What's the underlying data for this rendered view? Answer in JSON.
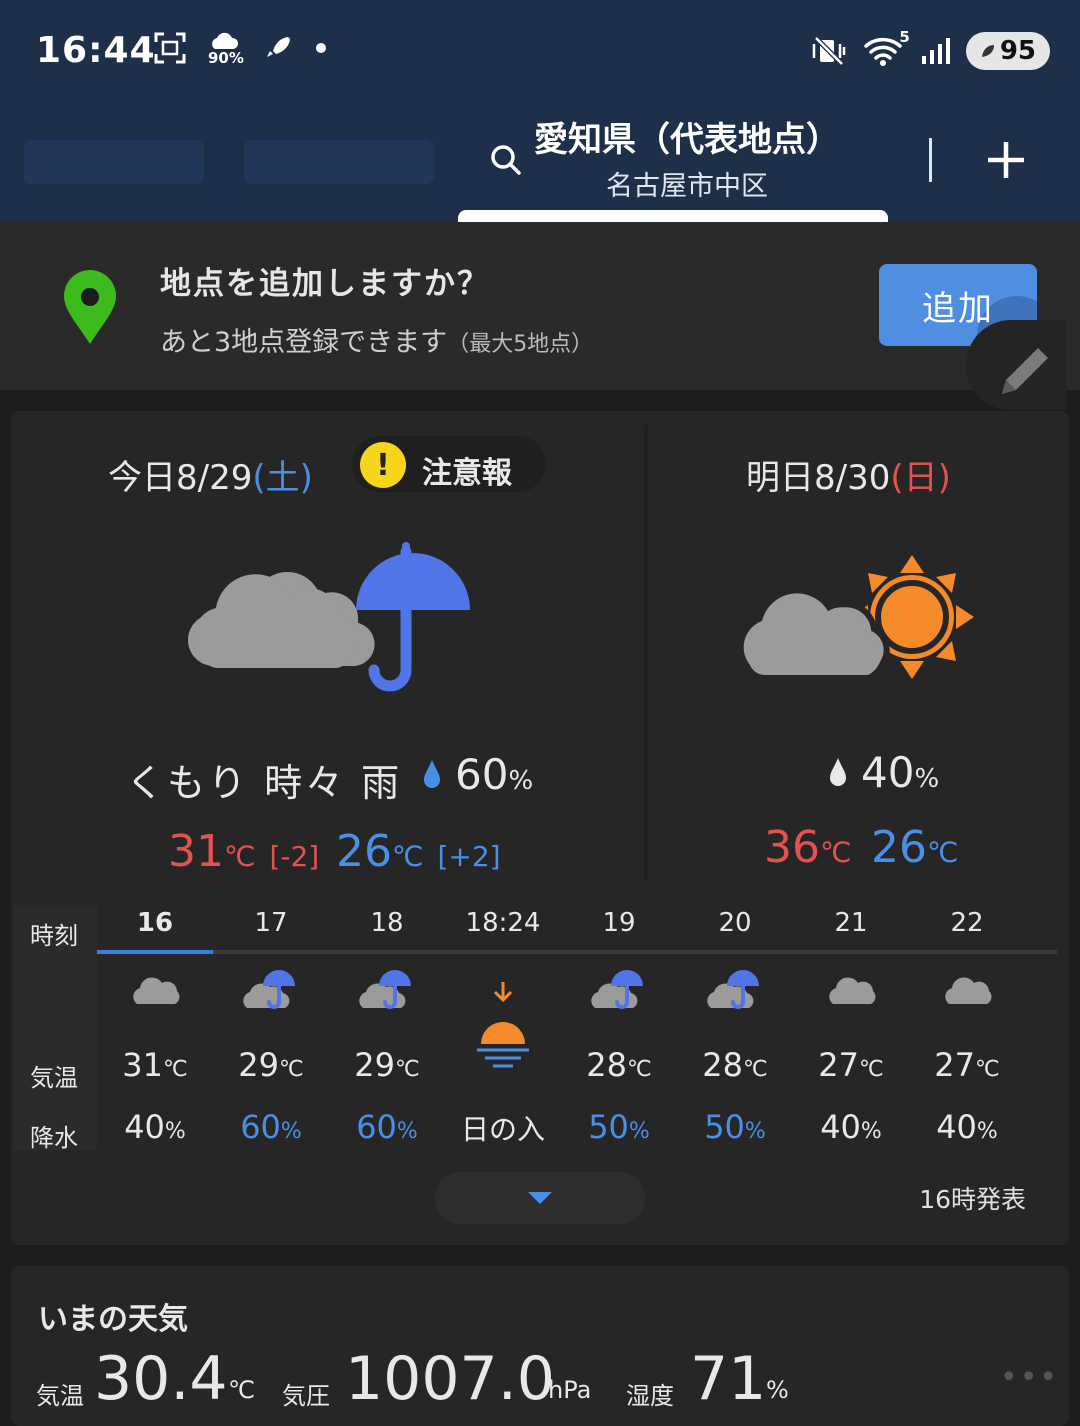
{
  "status_bar": {
    "time": "16:44",
    "rain_pct": "90%",
    "wifi_badge": "5",
    "battery": "95"
  },
  "header": {
    "location_title": "愛知県（代表地点）",
    "location_sub": "名古屋市中区"
  },
  "banner": {
    "title": "地点を追加しますか？",
    "sub": "あと3地点登録できます",
    "sub_small": "（最大5地点）",
    "add_label": "追加"
  },
  "today": {
    "date": "今日8/29",
    "weekday": "(土)",
    "warning": "注意報",
    "condition": "くもり 時々 雨",
    "pop": "60",
    "pop_unit": "%",
    "high": "31",
    "high_unit": "℃",
    "high_diff": "[-2]",
    "low": "26",
    "low_unit": "℃",
    "low_diff": "[+2]"
  },
  "tomorrow": {
    "date": "明日8/30",
    "weekday": "(日)",
    "pop": "40",
    "pop_unit": "%",
    "high": "36",
    "high_unit": "℃",
    "low": "26",
    "low_unit": "℃"
  },
  "hourly": {
    "labels": {
      "time": "時刻",
      "temp": "気温",
      "precip": "降水"
    },
    "hours": [
      "16",
      "17",
      "18",
      "18:24",
      "19",
      "20",
      "21",
      "22"
    ],
    "temps": [
      "31",
      "29",
      "29",
      "",
      "28",
      "28",
      "27",
      "27"
    ],
    "temp_unit": "℃",
    "precip": [
      "40",
      "60",
      "60",
      "日の入",
      "50",
      "50",
      "40",
      "40"
    ],
    "precip_unit": "%",
    "icons": [
      "cloud-icon",
      "cloud-rain-icon",
      "cloud-rain-icon",
      "sunset-icon",
      "cloud-rain-icon",
      "cloud-rain-icon",
      "cloud-icon",
      "cloud-icon"
    ],
    "issued": "16時発表"
  },
  "now": {
    "title": "いまの天気",
    "temp_label": "気温",
    "temp": "30.4",
    "temp_unit": "℃",
    "pressure_label": "気圧",
    "pressure": "1007.0",
    "pressure_unit": "hPa",
    "humidity_label": "湿度",
    "humidity": "71",
    "humidity_unit": "%"
  },
  "colors": {
    "header_bg": "#1e2f4a",
    "accent_blue": "#4a8fe6",
    "hot_red": "#e45151",
    "warning_yellow": "#f7d51d",
    "pin_green": "#3dbb1c",
    "sun_orange": "#f58a2a"
  }
}
